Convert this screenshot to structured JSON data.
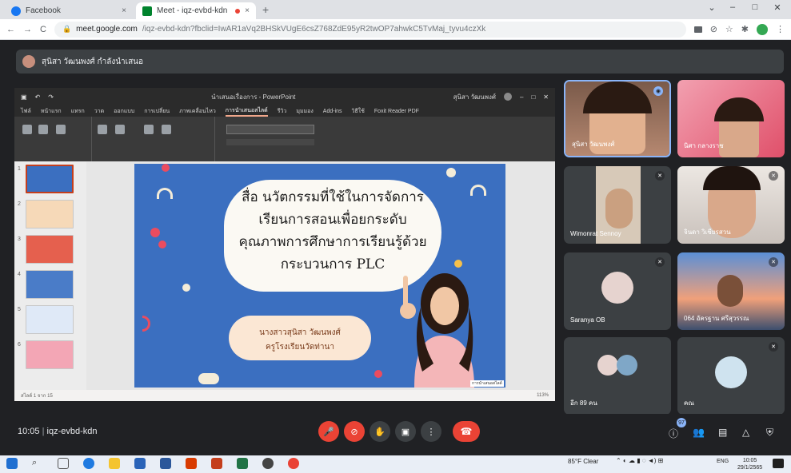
{
  "browser": {
    "tabs": [
      {
        "label": "Facebook",
        "close": "×"
      },
      {
        "label": "Meet - iqz-evbd-kdn",
        "close": "×"
      }
    ],
    "new_tab": "+",
    "window_buttons": [
      "⌄",
      "–",
      "□",
      "✕"
    ],
    "nav": {
      "back": "←",
      "forward": "→",
      "reload": "C"
    },
    "url_host": "meet.google.com",
    "url_rest": "/iqz-evbd-kdn?fbclid=IwAR1aVq2BHSkVUgE6csZ768ZdE95yR2twOP7ahwkC5TvMaj_tyvu4czXk"
  },
  "presenter_bar": {
    "text": "สุนิสา วัฒนพงศ์ กำลังนำเสนอ"
  },
  "ppt": {
    "doc_title": "นำเสนอเรื่องการ - PowerPoint",
    "user": "สุนิสา วัฒนพงศ์",
    "menu": [
      "ไฟล์",
      "หน้าแรก",
      "แทรก",
      "วาด",
      "ออกแบบ",
      "การเปลี่ยน",
      "ภาพเคลื่อนไหว",
      "การนำเสนอสไลด์",
      "รีวิว",
      "มุมมอง",
      "Add-ins",
      "วิธีใช้",
      "Foxit Reader PDF"
    ],
    "active_menu_index": 7,
    "thumb_numbers": [
      "1",
      "2",
      "3",
      "4",
      "5",
      "6"
    ],
    "status_left": "สไลด์ 1 จาก 15",
    "status_right": "113%"
  },
  "slide": {
    "lines": [
      "สื่อ นวัตกรรมที่ใช้ในการจัดการ",
      "เรียนการสอนเพื่อยกระดับ",
      "คุณภาพการศึกษาการเรียนรู้ด้วย",
      "กระบวนการ PLC"
    ],
    "sub_lines": [
      "นางสาวสุนิสา วัฒนพงศ์",
      "ครูโรงเรียนวัดท่านา"
    ],
    "tag": "การนำเสนอสไลด์"
  },
  "tiles": [
    {
      "name": "สุนิสา วัฒนพงศ์",
      "mic": "speaking"
    },
    {
      "name": "นิศา กลางราช",
      "mic": "none"
    },
    {
      "name": "Wimonrat Sennoy",
      "mic": "muted"
    },
    {
      "name": "จินดา วิเชียรสวน",
      "mic": "muted"
    },
    {
      "name": "Saranya OB",
      "mic": "muted"
    },
    {
      "name": "064 อัครฐาน ศรีสุวรรณ",
      "mic": "muted"
    },
    {
      "name": "อีก 89 คน",
      "mic": "none"
    },
    {
      "name": "คณ",
      "mic": "muted"
    }
  ],
  "meeting": {
    "time": "10:05",
    "code": "iqz-evbd-kdn",
    "people_count": "97"
  },
  "taskbar": {
    "weather": "85°F Clear",
    "lang": "ENG",
    "time": "10:05",
    "date": "29/1/2565"
  },
  "colors": {
    "meet_bg": "#202124",
    "tile_bg": "#3c4043",
    "red": "#ea4335",
    "slide_blue": "#3b6fc0"
  }
}
